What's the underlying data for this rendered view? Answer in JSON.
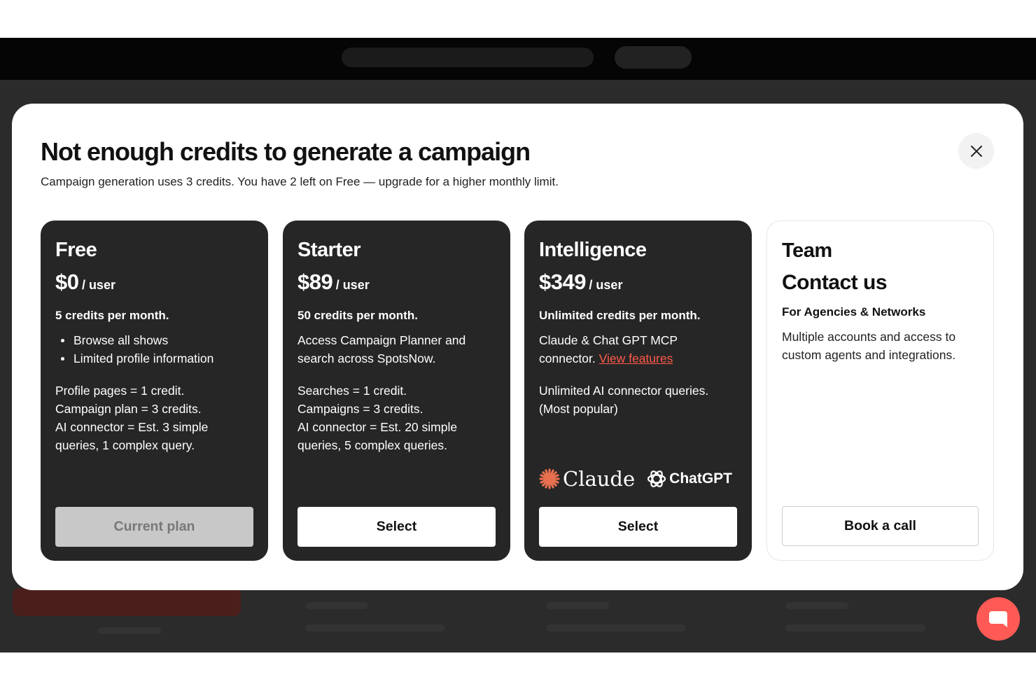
{
  "modal": {
    "title": "Not enough credits to generate a campaign",
    "subtitle": "Campaign generation uses 3 credits. You have 2 left on Free — upgrade for a higher monthly limit."
  },
  "plans": {
    "free": {
      "name": "Free",
      "price": "$0",
      "per": "/ user",
      "credits": "5 credits per month.",
      "bullets": [
        "Browse all shows",
        "Limited profile information"
      ],
      "notes": [
        "Profile pages = 1 credit.",
        "Campaign plan = 3 credits.",
        "AI connector = Est. 3 simple",
        "queries, 1 complex query."
      ],
      "button": "Current plan"
    },
    "starter": {
      "name": "Starter",
      "price": "$89",
      "per": "/ user",
      "credits": "50 credits per month.",
      "desc": [
        "Access Campaign Planner and",
        "search across SpotsNow."
      ],
      "notes": [
        "Searches = 1 credit.",
        "Campaigns = 3 credits.",
        "AI connector = Est. 20 simple",
        "queries, 5 complex queries."
      ],
      "button": "Select"
    },
    "intelligence": {
      "name": "Intelligence",
      "price": "$349",
      "per": "/ user",
      "credits": "Unlimited credits per month.",
      "desc_line1": "Claude & Chat GPT MCP",
      "desc_line2": "connector.",
      "link": "View features",
      "notes": [
        "Unlimited AI connector queries.",
        "(Most popular)"
      ],
      "logo_claude": "Claude",
      "logo_chatgpt": "ChatGPT",
      "button": "Select"
    },
    "team": {
      "name": "Team",
      "contact": "Contact us",
      "audience": "For Agencies & Networks",
      "desc": [
        "Multiple accounts and access to",
        "custom agents and integrations."
      ],
      "button": "Book a call"
    }
  },
  "colors": {
    "card_dark": "#262626",
    "accent_link": "#ff5a4a",
    "claude_orange": "#e8704f",
    "chat_fab": "#ff5a55"
  },
  "icons": {
    "close": "close-icon",
    "claude": "claude-starburst-icon",
    "chatgpt": "chatgpt-knot-icon",
    "chat": "chat-bubble-icon"
  }
}
